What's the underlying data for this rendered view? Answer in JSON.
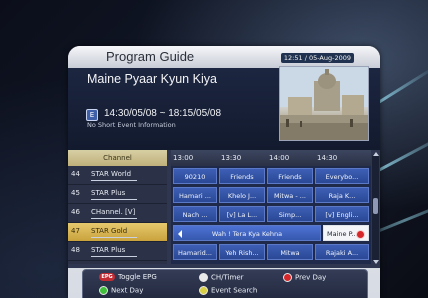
{
  "screen": {
    "title": "Program Guide",
    "datetime": "12:51 / 05-Aug-2009"
  },
  "event": {
    "title": "Maine Pyaar Kyun Kiya",
    "icon": "E",
    "time": "14:30/05/08 ~ 18:15/05/08",
    "description": "No Short Event Information"
  },
  "grid": {
    "channel_header": "Channel",
    "time_slots": [
      "13:00",
      "13:30",
      "14:00",
      "14:30"
    ],
    "channels": [
      {
        "num": "44",
        "name": "STAR World"
      },
      {
        "num": "45",
        "name": "STAR Plus"
      },
      {
        "num": "46",
        "name": "CHannel. [V]"
      },
      {
        "num": "47",
        "name": "STAR Gold"
      },
      {
        "num": "48",
        "name": "STAR Plus"
      }
    ],
    "active_channel_index": 3,
    "rows": [
      [
        "90210",
        "Friends",
        "Friends",
        "Everybo..."
      ],
      [
        "Hamari ...",
        "Khelo J...",
        "Mitwa - ...",
        "Raja K..."
      ],
      [
        "Nach ...",
        "[v] La L...",
        "Simp...",
        "[v] Engli..."
      ],
      [
        "Wah ! Tera Kya Kehna",
        "Maine P..."
      ],
      [
        "Hamarid...",
        "Yeh Rish...",
        "Mitwa",
        "Rajaki A..."
      ]
    ]
  },
  "footer": {
    "toggle_epg_key": "EPG",
    "toggle_epg": "Toggle EPG",
    "ch_timer": "CH/Timer",
    "prev_day": "Prev Day",
    "next_day": "Next Day",
    "event_search": "Event Search"
  },
  "colors": {
    "panel_dark": "#1c2640",
    "active_channel": "#e6c96e",
    "cell_blue": "#3d5fb5",
    "epg_key": "#c42c34",
    "yellow_key": "#d8cf45",
    "red_key": "#d6282b",
    "green_key": "#3fbf3a",
    "white_key": "#e8e8e8"
  }
}
